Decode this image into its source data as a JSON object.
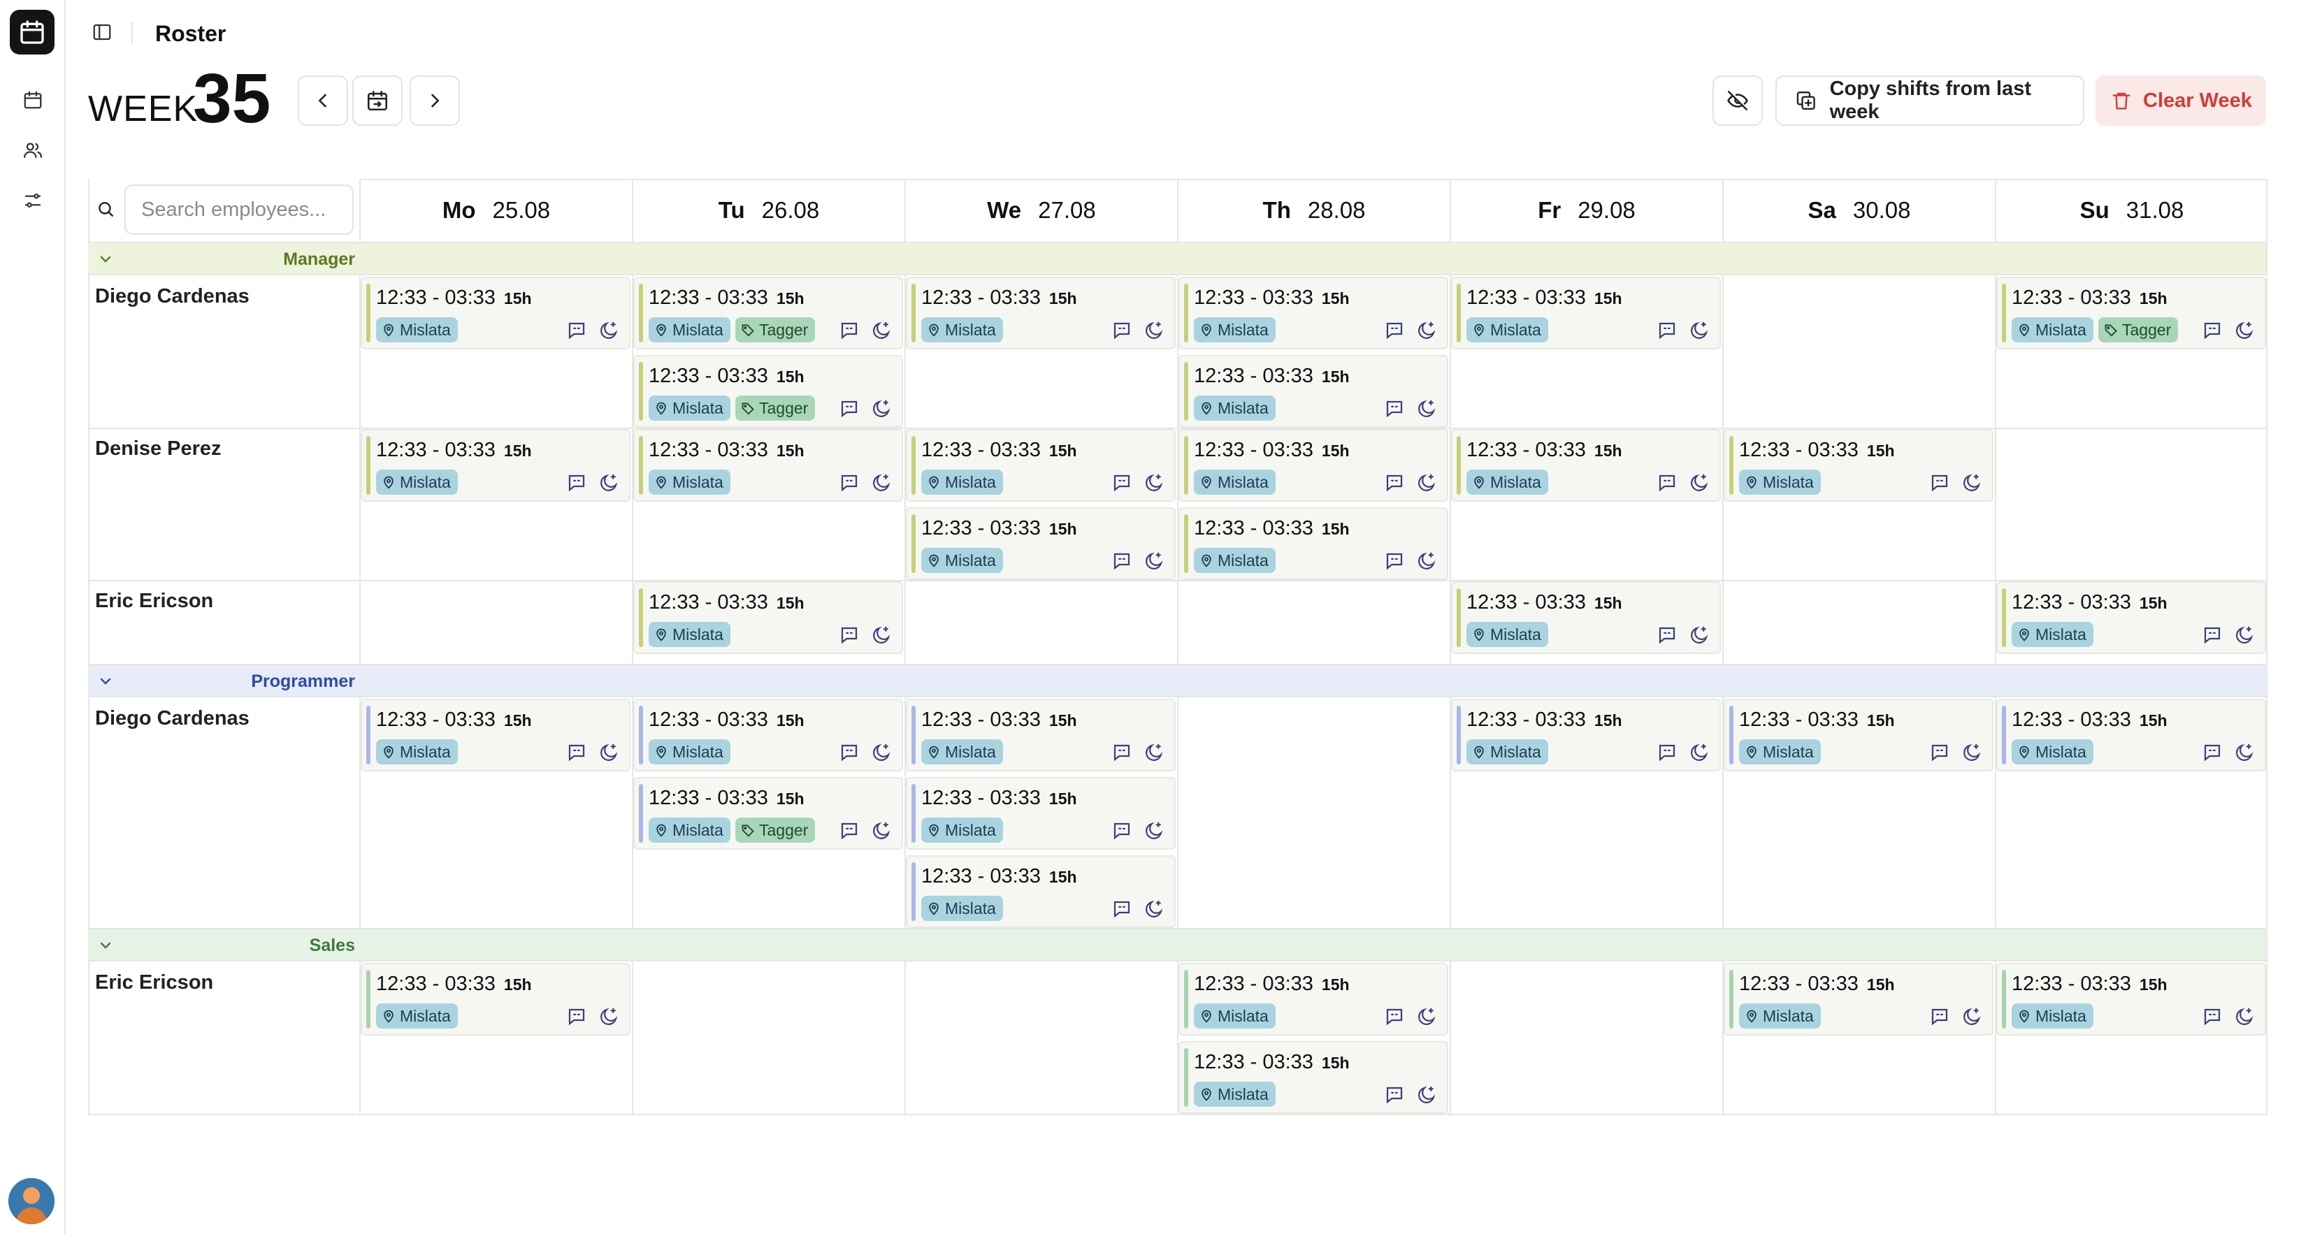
{
  "app": {
    "title": "Roster"
  },
  "header": {
    "week_label": "WEEK",
    "week_number": "35",
    "copy_label": "Copy shifts from last week",
    "clear_label": "Clear Week"
  },
  "search": {
    "placeholder": "Search employees..."
  },
  "days": [
    {
      "name": "Mo",
      "date": "25.08"
    },
    {
      "name": "Tu",
      "date": "26.08"
    },
    {
      "name": "We",
      "date": "27.08"
    },
    {
      "name": "Th",
      "date": "28.08"
    },
    {
      "name": "Fr",
      "date": "29.08"
    },
    {
      "name": "Sa",
      "date": "30.08"
    },
    {
      "name": "Su",
      "date": "31.08"
    }
  ],
  "shift_defaults": {
    "time": "12:33 - 03:33",
    "hours": "15h",
    "location": "Mislata",
    "tag": "Tagger"
  },
  "colors": {
    "manager_group_bg": "#edf3dc",
    "manager_group_text": "#5c7a1f",
    "manager_accent": "#c7cf79",
    "programmer_group_bg": "#e7ecf8",
    "programmer_group_text": "#2f4aa8",
    "programmer_accent": "#a9b6e6",
    "sales_group_bg": "#e6f2e6",
    "sales_group_text": "#3f7a3f",
    "sales_accent": "#a9d2ad",
    "location_tag": "#a9d3df",
    "tagger_tag": "#a9d6b8",
    "clear_bg": "#fbe9e8",
    "clear_text": "#d23b36"
  },
  "groups": [
    {
      "name": "Manager",
      "accent": "manager",
      "employees": [
        {
          "name": "Diego Cardenas",
          "shifts": [
            {
              "day": 0,
              "slot": 0,
              "tagger": false
            },
            {
              "day": 1,
              "slot": 0,
              "tagger": true
            },
            {
              "day": 2,
              "slot": 0,
              "tagger": false
            },
            {
              "day": 3,
              "slot": 0,
              "tagger": false
            },
            {
              "day": 4,
              "slot": 0,
              "tagger": false
            },
            {
              "day": 6,
              "slot": 0,
              "tagger": true
            },
            {
              "day": 1,
              "slot": 1,
              "tagger": true
            },
            {
              "day": 3,
              "slot": 1,
              "tagger": false
            }
          ]
        },
        {
          "name": "Denise Perez",
          "shifts": [
            {
              "day": 0,
              "slot": 0,
              "tagger": false
            },
            {
              "day": 1,
              "slot": 0,
              "tagger": false
            },
            {
              "day": 2,
              "slot": 0,
              "tagger": false
            },
            {
              "day": 3,
              "slot": 0,
              "tagger": false
            },
            {
              "day": 4,
              "slot": 0,
              "tagger": false
            },
            {
              "day": 5,
              "slot": 0,
              "tagger": false
            },
            {
              "day": 2,
              "slot": 1,
              "tagger": false
            },
            {
              "day": 3,
              "slot": 1,
              "tagger": false
            }
          ]
        },
        {
          "name": "Eric Ericson",
          "shifts": [
            {
              "day": 1,
              "slot": 0,
              "tagger": false
            },
            {
              "day": 4,
              "slot": 0,
              "tagger": false
            },
            {
              "day": 6,
              "slot": 0,
              "tagger": false
            }
          ]
        }
      ]
    },
    {
      "name": "Programmer",
      "accent": "programmer",
      "employees": [
        {
          "name": "Diego Cardenas",
          "shifts": [
            {
              "day": 0,
              "slot": 0,
              "tagger": false
            },
            {
              "day": 1,
              "slot": 0,
              "tagger": false
            },
            {
              "day": 2,
              "slot": 0,
              "tagger": false
            },
            {
              "day": 4,
              "slot": 0,
              "tagger": false
            },
            {
              "day": 5,
              "slot": 0,
              "tagger": false
            },
            {
              "day": 6,
              "slot": 0,
              "tagger": false
            },
            {
              "day": 1,
              "slot": 1,
              "tagger": true
            },
            {
              "day": 2,
              "slot": 1,
              "tagger": false
            },
            {
              "day": 2,
              "slot": 2,
              "tagger": false
            }
          ]
        }
      ]
    },
    {
      "name": "Sales",
      "accent": "sales",
      "employees": [
        {
          "name": "Eric Ericson",
          "shifts": [
            {
              "day": 0,
              "slot": 0,
              "tagger": false
            },
            {
              "day": 3,
              "slot": 0,
              "tagger": false
            },
            {
              "day": 5,
              "slot": 0,
              "tagger": false
            },
            {
              "day": 6,
              "slot": 0,
              "tagger": false
            },
            {
              "day": 3,
              "slot": 1,
              "tagger": false
            }
          ]
        }
      ]
    }
  ]
}
